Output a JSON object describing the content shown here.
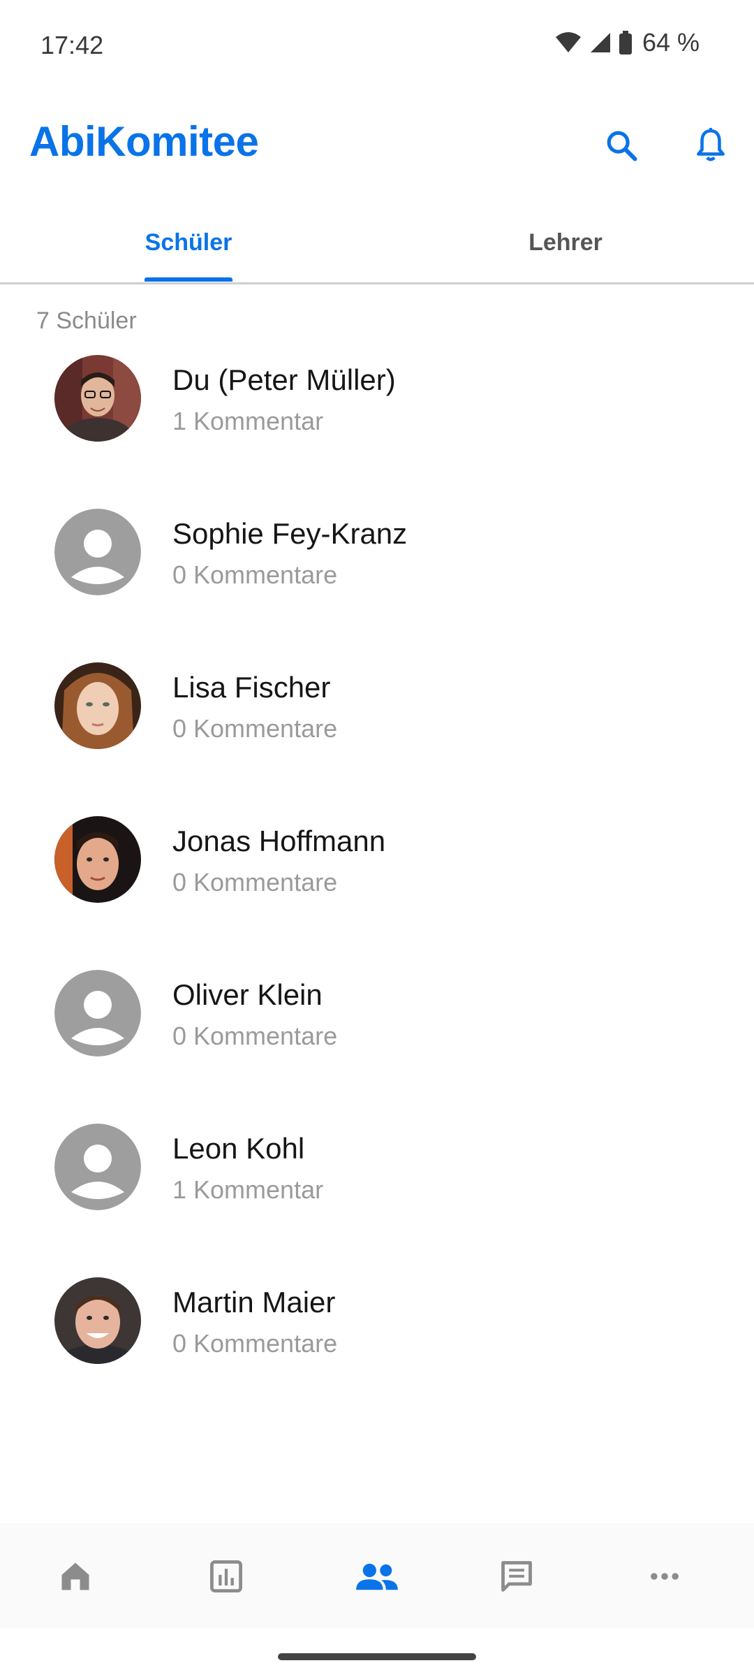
{
  "status_bar": {
    "time": "17:42",
    "battery": "64 %"
  },
  "header": {
    "title": "AbiKomitee",
    "search_icon": "search-icon",
    "bell_icon": "bell-icon"
  },
  "tabs": [
    {
      "label": "Schüler",
      "active": true
    },
    {
      "label": "Lehrer",
      "active": false
    }
  ],
  "list": {
    "count_label": "7 Schüler",
    "people": [
      {
        "name": "Du (Peter Müller)",
        "comments": "1 Kommentar",
        "avatar": "photo"
      },
      {
        "name": "Sophie Fey-Kranz",
        "comments": "0 Kommentare",
        "avatar": "placeholder"
      },
      {
        "name": "Lisa Fischer",
        "comments": "0 Kommentare",
        "avatar": "photo"
      },
      {
        "name": "Jonas Hoffmann",
        "comments": "0 Kommentare",
        "avatar": "photo"
      },
      {
        "name": "Oliver Klein",
        "comments": "0 Kommentare",
        "avatar": "placeholder"
      },
      {
        "name": "Leon Kohl",
        "comments": "1 Kommentar",
        "avatar": "placeholder"
      },
      {
        "name": "Martin Maier",
        "comments": "0 Kommentare",
        "avatar": "photo"
      }
    ]
  },
  "bottom_nav": [
    {
      "icon": "home-icon",
      "active": false
    },
    {
      "icon": "stats-icon",
      "active": false
    },
    {
      "icon": "people-icon",
      "active": true
    },
    {
      "icon": "chat-icon",
      "active": false
    },
    {
      "icon": "more-icon",
      "active": false
    }
  ],
  "colors": {
    "accent": "#0a73e8",
    "inactive_icon": "#8c8c8c",
    "placeholder_avatar": "#9e9e9e"
  }
}
